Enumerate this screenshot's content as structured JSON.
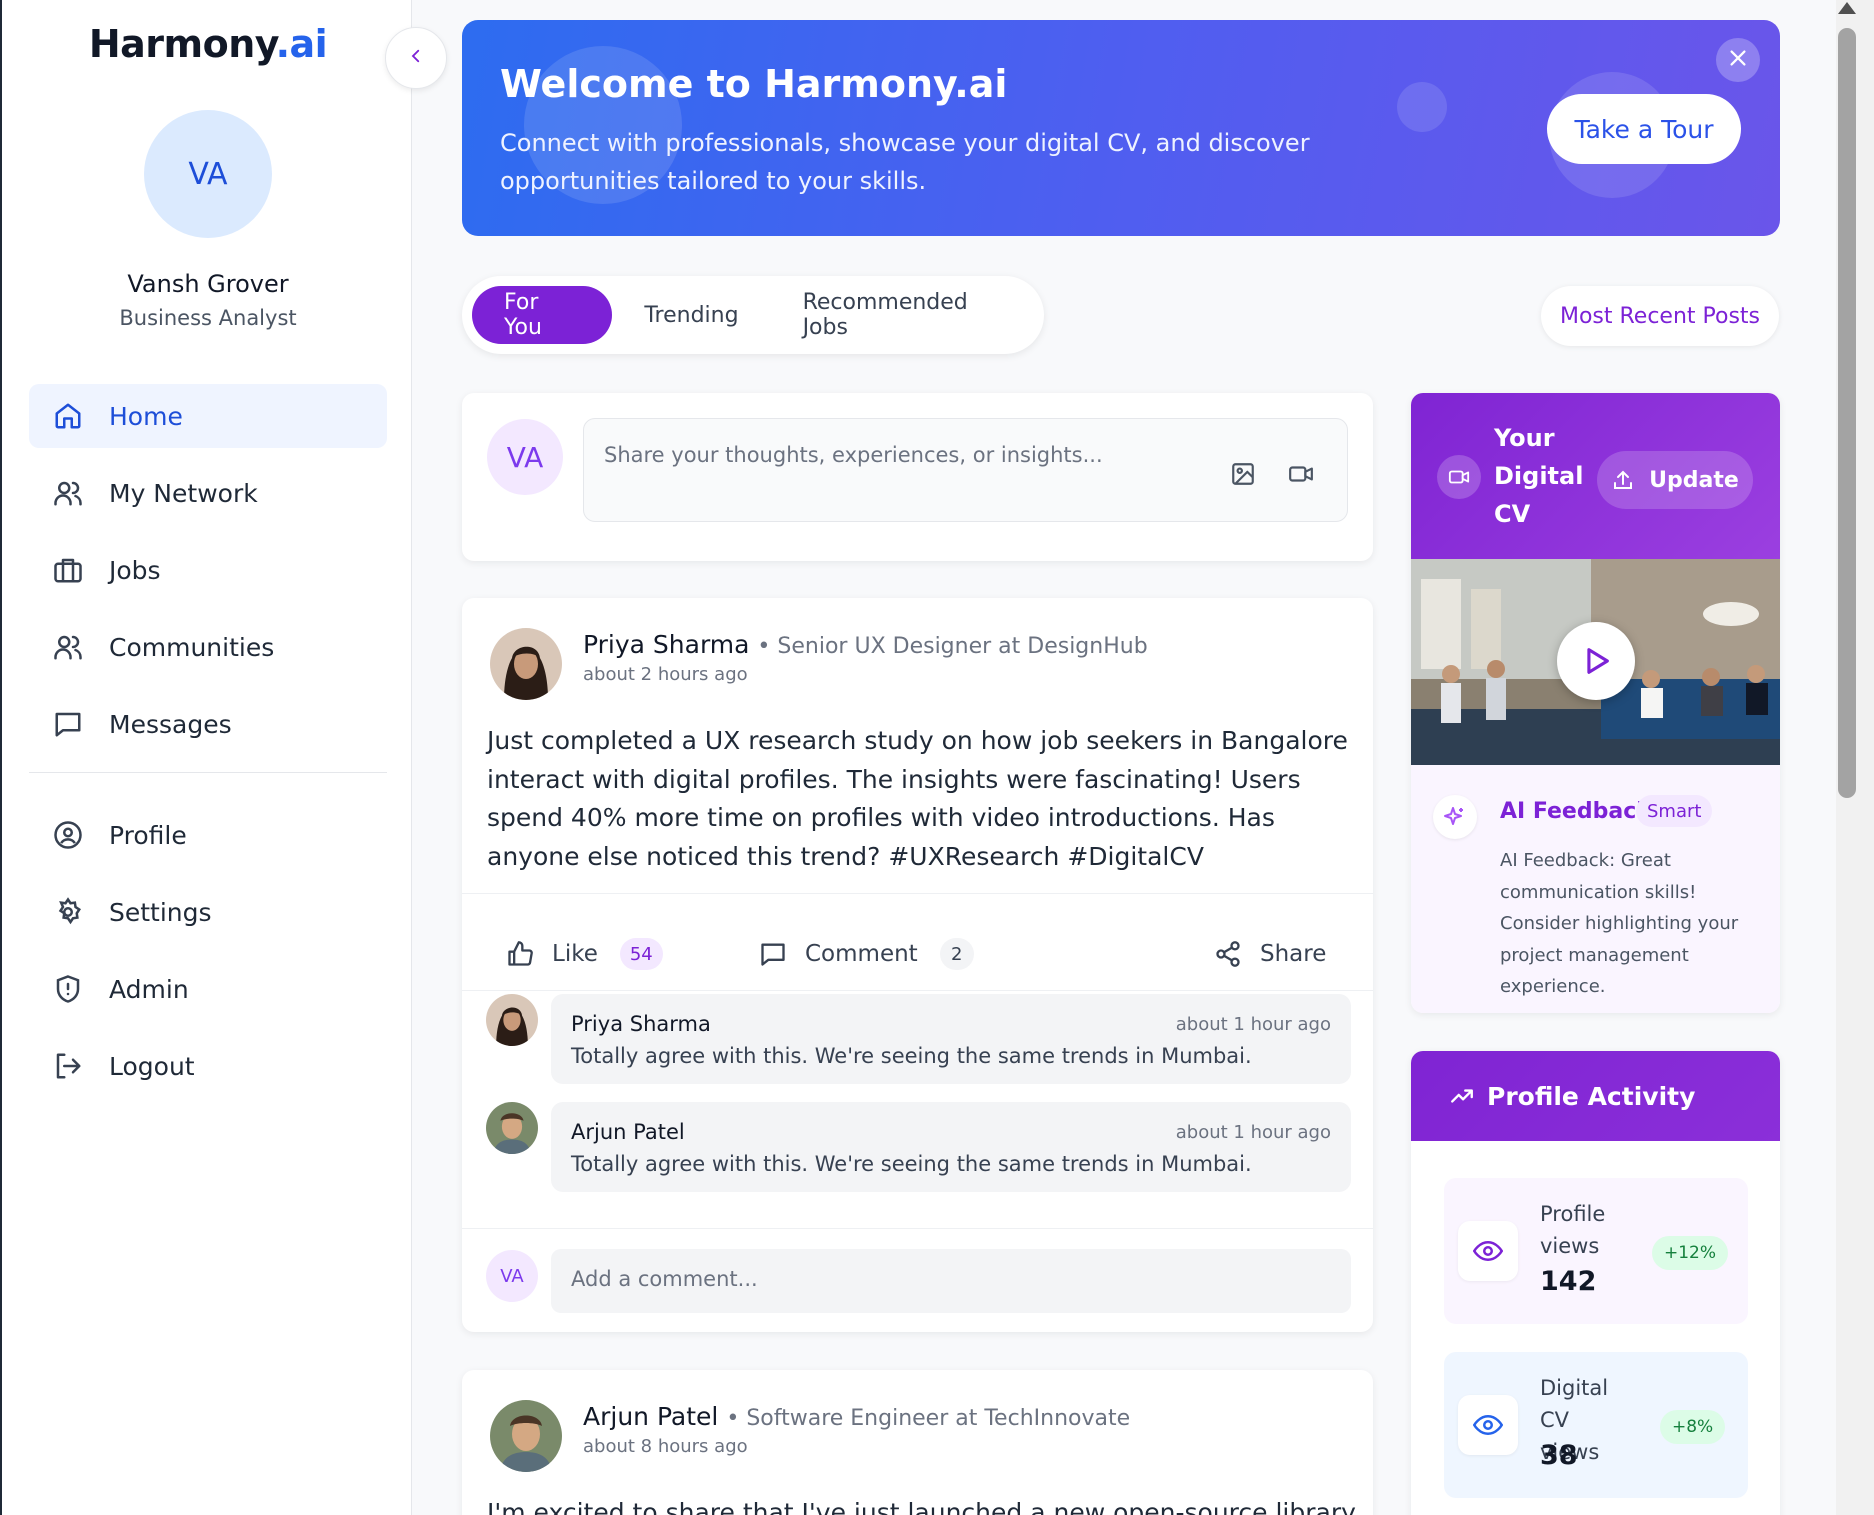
{
  "brand": {
    "name": "Harmony",
    "suffix": ".ai"
  },
  "user": {
    "initials": "VA",
    "name": "Vansh Grover",
    "role": "Business Analyst"
  },
  "nav": {
    "home": "Home",
    "network": "My Network",
    "jobs": "Jobs",
    "communities": "Communities",
    "messages": "Messages",
    "profile": "Profile",
    "settings": "Settings",
    "admin": "Admin",
    "logout": "Logout"
  },
  "banner": {
    "title": "Welcome to Harmony.ai",
    "subtitle": "Connect with professionals, showcase your digital CV, and discover opportunities tailored to your skills.",
    "tour_button": "Take a Tour"
  },
  "tabs": {
    "for_you": "For You",
    "trending": "Trending",
    "jobs": "Recommended Jobs",
    "sort": "Most Recent Posts"
  },
  "composer": {
    "initials": "VA",
    "placeholder": "Share your thoughts, experiences, or insights..."
  },
  "post1": {
    "author": "Priya Sharma",
    "role": "Senior UX Designer at DesignHub",
    "time": "about 2 hours ago",
    "body": "Just completed a UX research study on how job seekers in Bangalore interact with digital profiles. The insights were fascinating! Users spend 40% more time on profiles with video introductions. Has anyone else noticed this trend? #UXResearch #DigitalCV",
    "like_label": "Like",
    "likes": "54",
    "comment_label": "Comment",
    "comments": "2",
    "share_label": "Share",
    "comment_list": [
      {
        "name": "Priya Sharma",
        "time": "about 1 hour ago",
        "text": "Totally agree with this. We're seeing the same trends in Mumbai."
      },
      {
        "name": "Arjun Patel",
        "time": "about 1 hour ago",
        "text": "Totally agree with this. We're seeing the same trends in Mumbai."
      }
    ],
    "add_comment_initials": "VA",
    "add_comment_placeholder": "Add a comment..."
  },
  "post2": {
    "author": "Arjun Patel",
    "role": "Software Engineer at TechInnovate",
    "time": "about 8 hours ago",
    "body": "I'm excited to share that I've just launched a new open-source library for"
  },
  "digital_cv": {
    "title": "Your Digital CV",
    "update_label": "Update",
    "feedback_title": "AI Feedback",
    "feedback_badge": "Smart",
    "feedback_text": "AI Feedback: Great communication skills! Consider highlighting your project management experience."
  },
  "activity": {
    "title": "Profile Activity",
    "stats": [
      {
        "label": "Profile views",
        "value": "142",
        "change": "+12%"
      },
      {
        "label": "Digital CV views",
        "value": "38",
        "change": "+8%"
      }
    ]
  },
  "colors": {
    "accent": "#7c22d6",
    "brand_blue": "#2563eb",
    "banner_start": "#2d6cf0",
    "banner_end": "#6a55ea"
  }
}
